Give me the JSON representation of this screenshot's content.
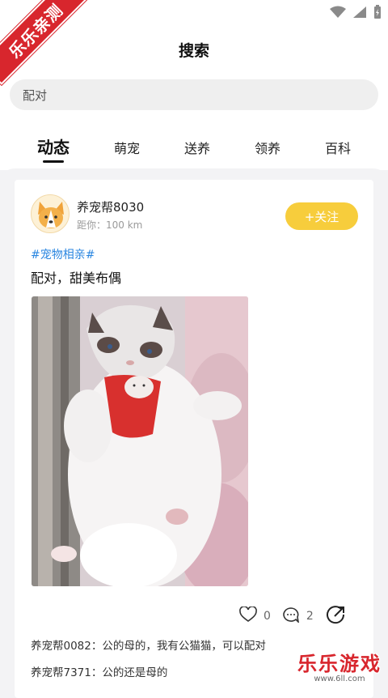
{
  "watermark": {
    "corner_ribbon": "乐乐亲测",
    "site_name": "乐乐游戏",
    "site_url": "www.6ll.com"
  },
  "status_bar": {
    "icons": [
      "wifi-icon",
      "signal-icon",
      "battery-charging-icon"
    ]
  },
  "header": {
    "title": "搜索"
  },
  "search": {
    "value": "配对",
    "placeholder": ""
  },
  "tabs": [
    {
      "label": "动态",
      "active": true
    },
    {
      "label": "萌宠",
      "active": false
    },
    {
      "label": "送养",
      "active": false
    },
    {
      "label": "领养",
      "active": false
    },
    {
      "label": "百科",
      "active": false
    }
  ],
  "post": {
    "author": "养宠帮8030",
    "distance": "距你：100 km",
    "follow_label": "+关注",
    "topic": "#宠物相亲#",
    "text": "配对，甜美布偶",
    "image_icon": "ragdoll-cat-photo",
    "likes": "0",
    "comments_count": "2",
    "comments": [
      {
        "text": "养宠帮0082：公的母的，我有公猫猫，可以配对"
      },
      {
        "text": "养宠帮7371：公的还是母的"
      }
    ]
  },
  "colors": {
    "accent": "#f7cd3c",
    "topic": "#2a86e0",
    "ribbon": "#d8262d"
  }
}
